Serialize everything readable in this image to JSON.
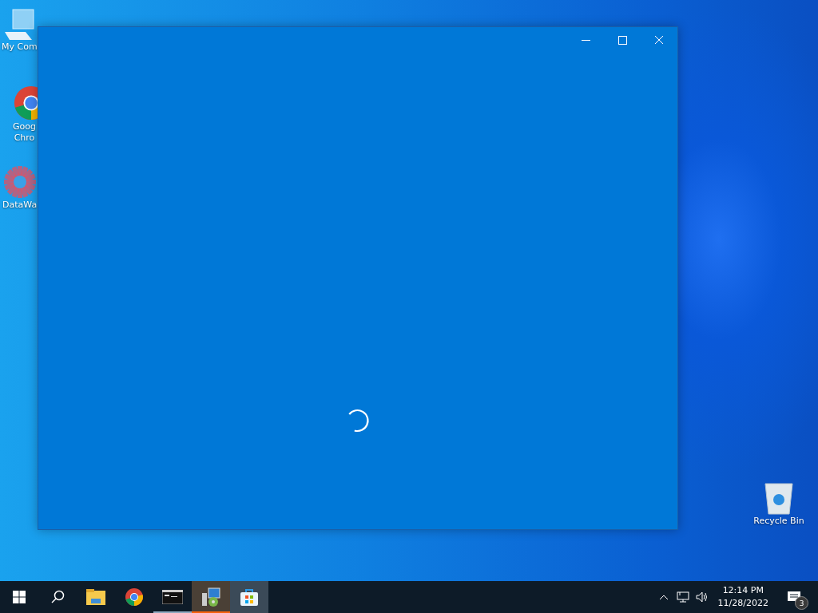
{
  "desktop_icons": [
    {
      "label": "My Com",
      "kind": "computer"
    },
    {
      "label": "Goog\nChro",
      "kind": "chrome"
    },
    {
      "label": "DataWa",
      "kind": "gear"
    }
  ],
  "recycle_bin": {
    "label": "Recycle Bin"
  },
  "window": {
    "loading": true
  },
  "taskbar": {
    "apps": [
      {
        "kind": "folder",
        "running": false,
        "flashing": false,
        "selected": false
      },
      {
        "kind": "chrome",
        "running": false,
        "flashing": false,
        "selected": false
      },
      {
        "kind": "terminal",
        "running": true,
        "flashing": false,
        "selected": false
      },
      {
        "kind": "installer",
        "running": true,
        "flashing": true,
        "selected": false
      },
      {
        "kind": "store",
        "running": true,
        "flashing": false,
        "selected": true
      }
    ],
    "time": "12:14 PM",
    "date": "11/28/2022",
    "notification_count": "3"
  }
}
